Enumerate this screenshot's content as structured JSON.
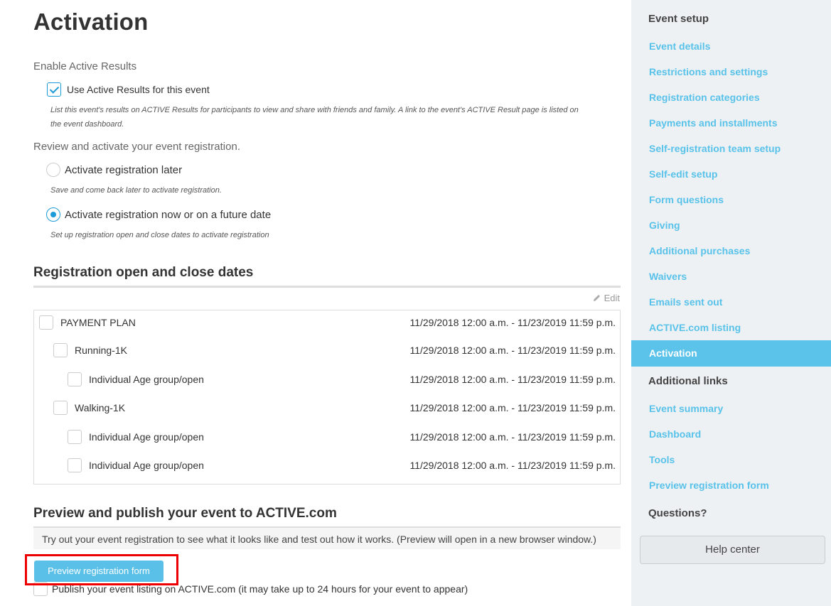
{
  "page": {
    "title": "Activation"
  },
  "results": {
    "section_label": "Enable Active Results",
    "checkbox_label": "Use Active Results for this event",
    "checked": true,
    "help_line1": "List this event's results on ACTIVE Results for participants to view and share with friends and family. A link to the event's ACTIVE Result page is listed on",
    "help_line2": "the event dashboard."
  },
  "activation": {
    "section_label": "Review and activate your event registration.",
    "option_later": {
      "label": "Activate registration later",
      "help": "Save and come back later to activate registration.",
      "selected": false
    },
    "option_now": {
      "label": "Activate registration now or on a future date",
      "help": "Set up registration open and close dates to activate registration",
      "selected": true
    }
  },
  "dates": {
    "heading": "Registration open and close dates",
    "edit_label": "Edit",
    "rows": [
      {
        "name": "PAYMENT PLAN",
        "range": "11/29/2018 12:00 a.m. - 11/23/2019 11:59 p.m.",
        "level": 0
      },
      {
        "name": "Running-1K",
        "range": "11/29/2018 12:00 a.m. - 11/23/2019 11:59 p.m.",
        "level": 1
      },
      {
        "name": "Individual Age group/open",
        "range": "11/29/2018 12:00 a.m. - 11/23/2019 11:59 p.m.",
        "level": 2
      },
      {
        "name": "Walking-1K",
        "range": "11/29/2018 12:00 a.m. - 11/23/2019 11:59 p.m.",
        "level": 1
      },
      {
        "name": "Individual Age group/open",
        "range": "11/29/2018 12:00 a.m. - 11/23/2019 11:59 p.m.",
        "level": 2
      },
      {
        "name": "Individual Age group/open",
        "range": "11/29/2018 12:00 a.m. - 11/23/2019 11:59 p.m.",
        "level": 2
      }
    ]
  },
  "publish": {
    "heading": "Preview and publish your event to ACTIVE.com",
    "note": "Try out your event registration to see what it looks like and test out how it works. (Preview will open in a new browser window.)",
    "preview_button": "Preview registration form",
    "publish_label": "Publish your event listing on ACTIVE.com (it may take up to 24 hours for your event to appear)"
  },
  "sidebar": {
    "setup_heading": "Event setup",
    "setup_items": [
      "Event details",
      "Restrictions and settings",
      "Registration categories",
      "Payments and installments",
      "Self-registration team setup",
      "Self-edit setup",
      "Form questions",
      "Giving",
      "Additional purchases",
      "Waivers",
      "Emails sent out",
      "ACTIVE.com listing"
    ],
    "active_item": "Activation",
    "links_heading": "Additional links",
    "link_items": [
      "Event summary",
      "Dashboard",
      "Tools",
      "Preview registration form"
    ],
    "questions_heading": "Questions?",
    "help_button": "Help center"
  },
  "colors": {
    "accent": "#5bc3ea",
    "link": "#58c2ea",
    "highlight": "#e00000"
  }
}
